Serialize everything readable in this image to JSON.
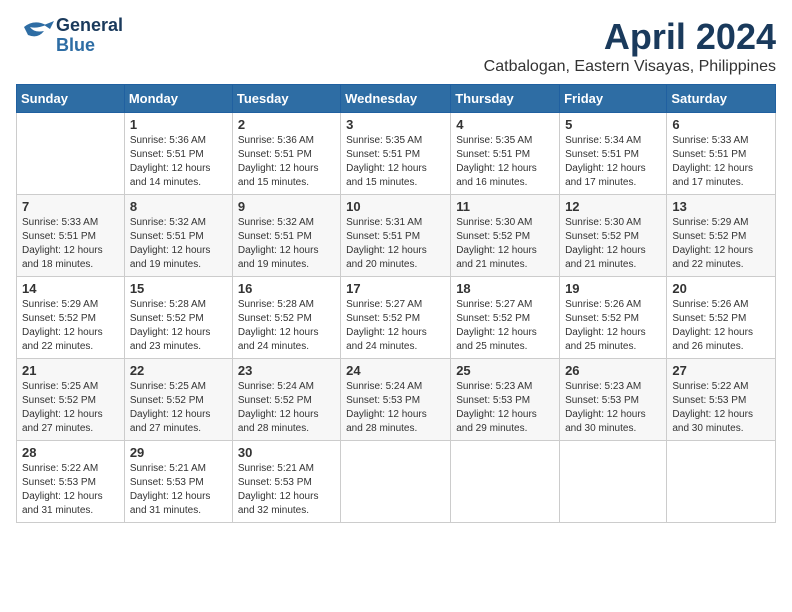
{
  "logo": {
    "part1": "General",
    "part2": "Blue"
  },
  "title": "April 2024",
  "location": "Catbalogan, Eastern Visayas, Philippines",
  "days_of_week": [
    "Sunday",
    "Monday",
    "Tuesday",
    "Wednesday",
    "Thursday",
    "Friday",
    "Saturday"
  ],
  "weeks": [
    [
      {
        "day": "",
        "info": ""
      },
      {
        "day": "1",
        "info": "Sunrise: 5:36 AM\nSunset: 5:51 PM\nDaylight: 12 hours\nand 14 minutes."
      },
      {
        "day": "2",
        "info": "Sunrise: 5:36 AM\nSunset: 5:51 PM\nDaylight: 12 hours\nand 15 minutes."
      },
      {
        "day": "3",
        "info": "Sunrise: 5:35 AM\nSunset: 5:51 PM\nDaylight: 12 hours\nand 15 minutes."
      },
      {
        "day": "4",
        "info": "Sunrise: 5:35 AM\nSunset: 5:51 PM\nDaylight: 12 hours\nand 16 minutes."
      },
      {
        "day": "5",
        "info": "Sunrise: 5:34 AM\nSunset: 5:51 PM\nDaylight: 12 hours\nand 17 minutes."
      },
      {
        "day": "6",
        "info": "Sunrise: 5:33 AM\nSunset: 5:51 PM\nDaylight: 12 hours\nand 17 minutes."
      }
    ],
    [
      {
        "day": "7",
        "info": "Sunrise: 5:33 AM\nSunset: 5:51 PM\nDaylight: 12 hours\nand 18 minutes."
      },
      {
        "day": "8",
        "info": "Sunrise: 5:32 AM\nSunset: 5:51 PM\nDaylight: 12 hours\nand 19 minutes."
      },
      {
        "day": "9",
        "info": "Sunrise: 5:32 AM\nSunset: 5:51 PM\nDaylight: 12 hours\nand 19 minutes."
      },
      {
        "day": "10",
        "info": "Sunrise: 5:31 AM\nSunset: 5:51 PM\nDaylight: 12 hours\nand 20 minutes."
      },
      {
        "day": "11",
        "info": "Sunrise: 5:30 AM\nSunset: 5:52 PM\nDaylight: 12 hours\nand 21 minutes."
      },
      {
        "day": "12",
        "info": "Sunrise: 5:30 AM\nSunset: 5:52 PM\nDaylight: 12 hours\nand 21 minutes."
      },
      {
        "day": "13",
        "info": "Sunrise: 5:29 AM\nSunset: 5:52 PM\nDaylight: 12 hours\nand 22 minutes."
      }
    ],
    [
      {
        "day": "14",
        "info": "Sunrise: 5:29 AM\nSunset: 5:52 PM\nDaylight: 12 hours\nand 22 minutes."
      },
      {
        "day": "15",
        "info": "Sunrise: 5:28 AM\nSunset: 5:52 PM\nDaylight: 12 hours\nand 23 minutes."
      },
      {
        "day": "16",
        "info": "Sunrise: 5:28 AM\nSunset: 5:52 PM\nDaylight: 12 hours\nand 24 minutes."
      },
      {
        "day": "17",
        "info": "Sunrise: 5:27 AM\nSunset: 5:52 PM\nDaylight: 12 hours\nand 24 minutes."
      },
      {
        "day": "18",
        "info": "Sunrise: 5:27 AM\nSunset: 5:52 PM\nDaylight: 12 hours\nand 25 minutes."
      },
      {
        "day": "19",
        "info": "Sunrise: 5:26 AM\nSunset: 5:52 PM\nDaylight: 12 hours\nand 25 minutes."
      },
      {
        "day": "20",
        "info": "Sunrise: 5:26 AM\nSunset: 5:52 PM\nDaylight: 12 hours\nand 26 minutes."
      }
    ],
    [
      {
        "day": "21",
        "info": "Sunrise: 5:25 AM\nSunset: 5:52 PM\nDaylight: 12 hours\nand 27 minutes."
      },
      {
        "day": "22",
        "info": "Sunrise: 5:25 AM\nSunset: 5:52 PM\nDaylight: 12 hours\nand 27 minutes."
      },
      {
        "day": "23",
        "info": "Sunrise: 5:24 AM\nSunset: 5:52 PM\nDaylight: 12 hours\nand 28 minutes."
      },
      {
        "day": "24",
        "info": "Sunrise: 5:24 AM\nSunset: 5:53 PM\nDaylight: 12 hours\nand 28 minutes."
      },
      {
        "day": "25",
        "info": "Sunrise: 5:23 AM\nSunset: 5:53 PM\nDaylight: 12 hours\nand 29 minutes."
      },
      {
        "day": "26",
        "info": "Sunrise: 5:23 AM\nSunset: 5:53 PM\nDaylight: 12 hours\nand 30 minutes."
      },
      {
        "day": "27",
        "info": "Sunrise: 5:22 AM\nSunset: 5:53 PM\nDaylight: 12 hours\nand 30 minutes."
      }
    ],
    [
      {
        "day": "28",
        "info": "Sunrise: 5:22 AM\nSunset: 5:53 PM\nDaylight: 12 hours\nand 31 minutes."
      },
      {
        "day": "29",
        "info": "Sunrise: 5:21 AM\nSunset: 5:53 PM\nDaylight: 12 hours\nand 31 minutes."
      },
      {
        "day": "30",
        "info": "Sunrise: 5:21 AM\nSunset: 5:53 PM\nDaylight: 12 hours\nand 32 minutes."
      },
      {
        "day": "",
        "info": ""
      },
      {
        "day": "",
        "info": ""
      },
      {
        "day": "",
        "info": ""
      },
      {
        "day": "",
        "info": ""
      }
    ]
  ]
}
